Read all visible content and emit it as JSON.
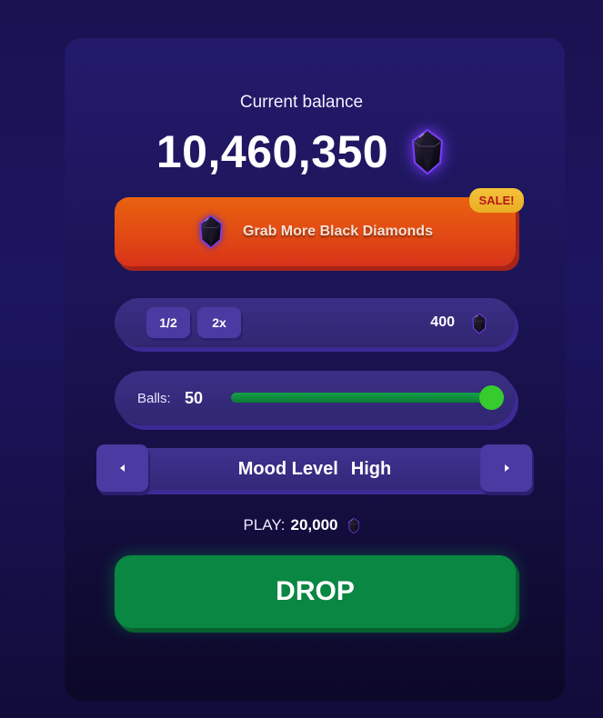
{
  "balance": {
    "label": "Current balance",
    "value": "10,460,350",
    "currency_icon": "black-diamond-icon"
  },
  "promo": {
    "label": "Grab More Black Diamonds",
    "badge": "SALE!",
    "icon": "black-diamond-icon",
    "colors": {
      "button": "#e24a14",
      "badge": "#f4c23b",
      "badge_text": "#b8161e"
    }
  },
  "bet": {
    "half_label": "1/2",
    "double_label": "2x",
    "amount": "400",
    "currency_icon": "black-diamond-icon"
  },
  "balls": {
    "label": "Balls:",
    "value": "50",
    "slider_fraction": 1.0,
    "colors": {
      "fill": "#15a04a",
      "thumb": "#36cc2e"
    }
  },
  "mood": {
    "label": "Mood Level",
    "value": "High",
    "prev_icon": "chevron-left-icon",
    "next_icon": "chevron-right-icon"
  },
  "play": {
    "label": "PLAY:",
    "value": "20,000",
    "currency_icon": "black-diamond-icon"
  },
  "drop": {
    "label": "DROP",
    "color": "#0a8743"
  }
}
